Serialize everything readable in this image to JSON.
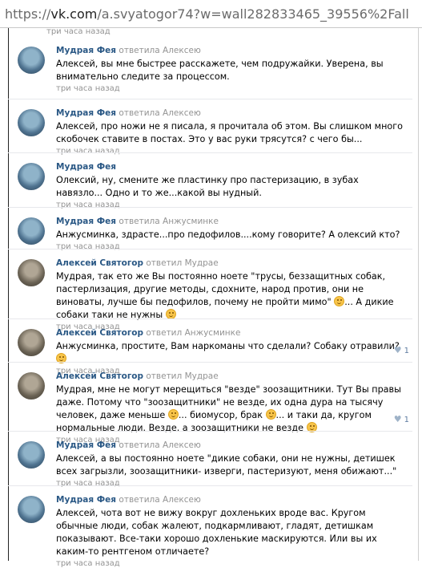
{
  "address_bar": {
    "protocol": "https://",
    "domain": "vk.com",
    "path": "/a.svyatogor74?w=wall282833465_39556%2Fall"
  },
  "top_stub": "три часа назад",
  "colors": {
    "link": "#2a5885",
    "meta": "#939393",
    "like": "#5d7ba0"
  },
  "comments": [
    {
      "author": "Мудрая Фея",
      "verb": "ответила",
      "target": "Алексею",
      "text": "Алексей, вы мне быстрее расскажете, чем подружайки. Уверена, вы внимательно следите за процессом.",
      "time": "три часа назад"
    },
    {
      "author": "Мудрая Фея",
      "verb": "ответила",
      "target": "Алексею",
      "text": "Алексей, про ножи не я писала, я прочитала об этом. Вы слишком много скобочек ставите в постах. Это у вас руки трясутся? с чего бы...",
      "time": "три часа назад"
    },
    {
      "author": "Мудрая Фея",
      "verb": "",
      "target": "",
      "text": "Олексий, ну, смените же пластинку про пастеризацию, в зубах навязло... Одно и то же...какой вы нудный.",
      "time": "три часа назад"
    },
    {
      "author": "Мудрая Фея",
      "verb": "ответила",
      "target": "Анжусминке",
      "text": "Анжусминка, здрасте...про педофилов....кому говорите? А олексий кто?",
      "time": "три часа назад"
    },
    {
      "author": "Алексей Святогор",
      "verb": "ответил",
      "target": "Мудрае",
      "text_a": "Мудрая, так ето же Вы постоянно ноете \"трусы, беззащитных собак, пастерлизация, другие методы, сдохните, народ против, они не виноваты, лучше бы педофилов, почему не пройти мимо\"",
      "text_b": "... А дикие собаки таки не нужны",
      "time": "три часа назад"
    },
    {
      "author": "Алексей Святогор",
      "verb": "ответил",
      "target": "Анжусминке",
      "text": "Анжусминка, простите, Вам наркоманы что сделали? Собаку отравили?",
      "time": "три часа назад",
      "likes": "1"
    },
    {
      "author": "Алексей Святогор",
      "verb": "ответил",
      "target": "Мудрае",
      "text_a": "Мудрая, мне не могут мерещиться \"везде\" зоозащитники. Тут Вы правы даже. Потому что \"зоозащитники\" не везде, их одна дура на тысячу человек, даже меньше",
      "text_b": "... биомусор, брак",
      "text_c": "... и таки да, кругом нормальные люди. Везде. а зоозащитники не везде",
      "time": "три часа назад",
      "likes": "1"
    },
    {
      "author": "Мудрая Фея",
      "verb": "ответила",
      "target": "Алексею",
      "text": "Алексей, а вы постоянно ноете \"дикие собаки, они не нужны, детишек всех загрызли, зоозащитники- изверги, пастеризуют, меня обижают...\"",
      "time": "три часа назад"
    },
    {
      "author": "Мудрая Фея",
      "verb": "ответила",
      "target": "Алексею",
      "text": "Алексей, чота вот не вижу вокруг дохленьких вроде вас. Кругом обычные люди, собак жалеют, подкармливают, гладят, детишкам показывают. Все-таки хорошо дохленькие маскируются. Или вы их каким-то рентгеном отличаете?",
      "time": "три часа назад"
    }
  ]
}
